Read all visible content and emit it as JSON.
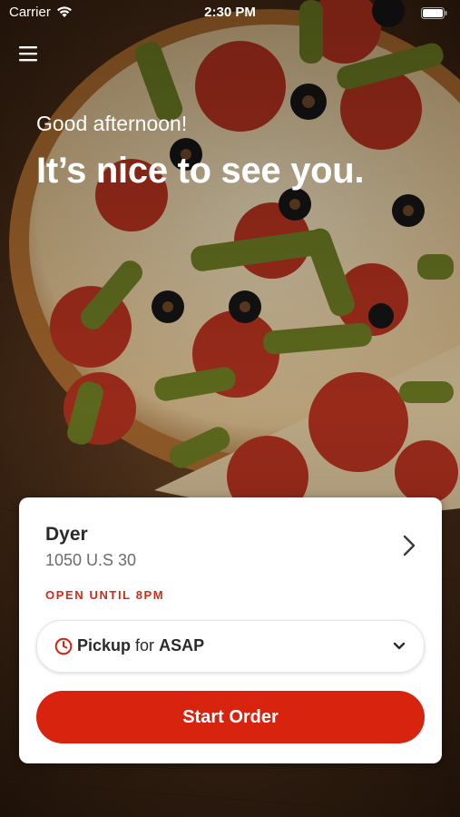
{
  "status_bar": {
    "carrier": "Carrier",
    "time": "2:30 PM"
  },
  "header": {
    "menu_icon": "hamburger-menu-icon"
  },
  "hero": {
    "greeting": "Good afternoon!",
    "headline": "It’s nice to see you."
  },
  "store_card": {
    "store_name": "Dyer",
    "address": "1050 U.S 30",
    "hours": "OPEN UNTIL 8PM",
    "order_mode": "Pickup",
    "order_connector": "for",
    "order_time": "ASAP",
    "start_button_label": "Start Order",
    "colors": {
      "accent": "#d8230f",
      "hours_text": "#d52a17"
    }
  }
}
